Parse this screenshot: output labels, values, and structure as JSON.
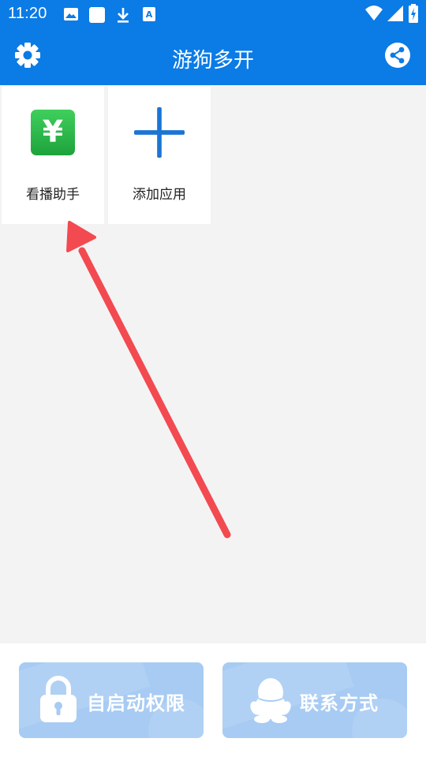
{
  "status_bar": {
    "time": "11:20",
    "icons": [
      "image-icon",
      "blank-square-icon",
      "download-icon",
      "a-badge-icon",
      "wifi-icon",
      "signal-icon",
      "battery-charging-icon"
    ]
  },
  "header": {
    "title": "游狗多开",
    "left_icon": "gear-icon",
    "right_icon": "share-icon"
  },
  "apps": [
    {
      "label": "看播助手",
      "icon": "yen-money-icon",
      "icon_color": "#22b14c"
    },
    {
      "label": "添加应用",
      "icon": "plus-icon",
      "icon_color": "#1a74d4"
    }
  ],
  "bottom_buttons": [
    {
      "label": "自启动权限",
      "icon": "lock-icon"
    },
    {
      "label": "联系方式",
      "icon": "qq-penguin-icon"
    }
  ],
  "colors": {
    "primary": "#0b7be6",
    "button_bg": "#a7cbf3",
    "arrow": "#f24a50",
    "background": "#f4f3f4"
  }
}
